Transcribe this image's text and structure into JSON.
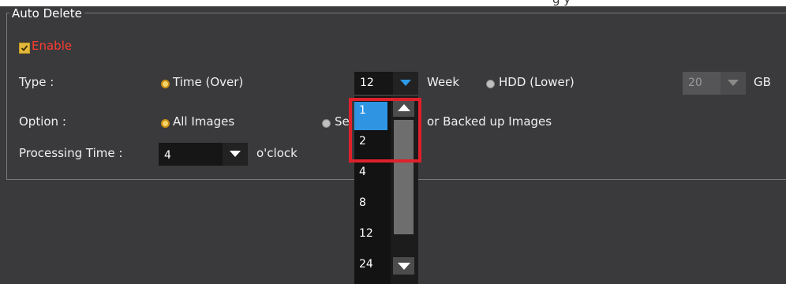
{
  "header": {
    "partial_text": "g                y"
  },
  "group": {
    "title": "Auto Delete"
  },
  "enable": {
    "label": "Enable",
    "checked": true
  },
  "type": {
    "label": "Type :",
    "time_option": "Time (Over)",
    "time_value": "12",
    "time_unit": "Week",
    "hdd_option": "HDD (Lower)",
    "hdd_value": "20",
    "hdd_unit": "GB"
  },
  "option": {
    "label": "Option :",
    "all_images": "All Images",
    "second_option_partial": "Se",
    "backed_up": "or Backed up Images"
  },
  "processing": {
    "label": "Processing Time :",
    "value": "4",
    "unit": "o'clock"
  },
  "dropdown": {
    "items": [
      "1",
      "2",
      "4",
      "8",
      "12",
      "24"
    ],
    "selected": "1"
  },
  "colors": {
    "background": "#3a3a3c",
    "accent_blue": "#2f95e3",
    "highlight_red": "#e0202a",
    "enable_red": "#ff3b30"
  }
}
